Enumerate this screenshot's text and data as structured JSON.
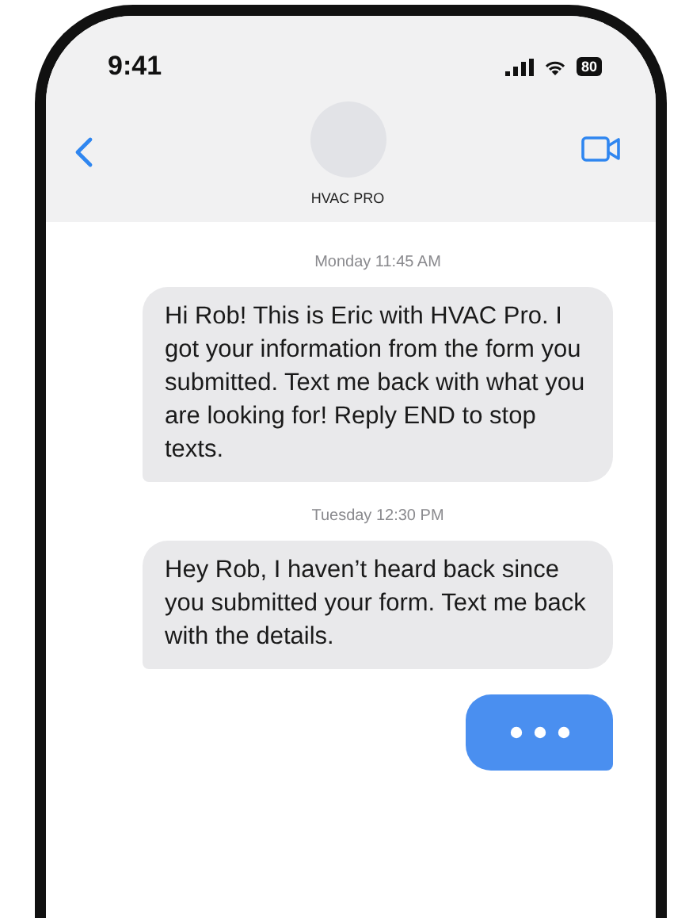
{
  "status_bar": {
    "time": "9:41",
    "battery": "80"
  },
  "contact": {
    "name": "HVAC PRO"
  },
  "messages": [
    {
      "kind": "timestamp",
      "text": "Monday 11:45 AM"
    },
    {
      "kind": "incoming",
      "text": "Hi Rob! This is Eric with HVAC Pro. I got your information from the form you submitted. Text me back with what you are looking for! Reply END to stop texts."
    },
    {
      "kind": "timestamp",
      "text": "Tuesday 12:30 PM"
    },
    {
      "kind": "incoming",
      "text": "Hey Rob, I haven’t heard back since you submitted your form. Text me back with the details."
    },
    {
      "kind": "typing"
    }
  ]
}
